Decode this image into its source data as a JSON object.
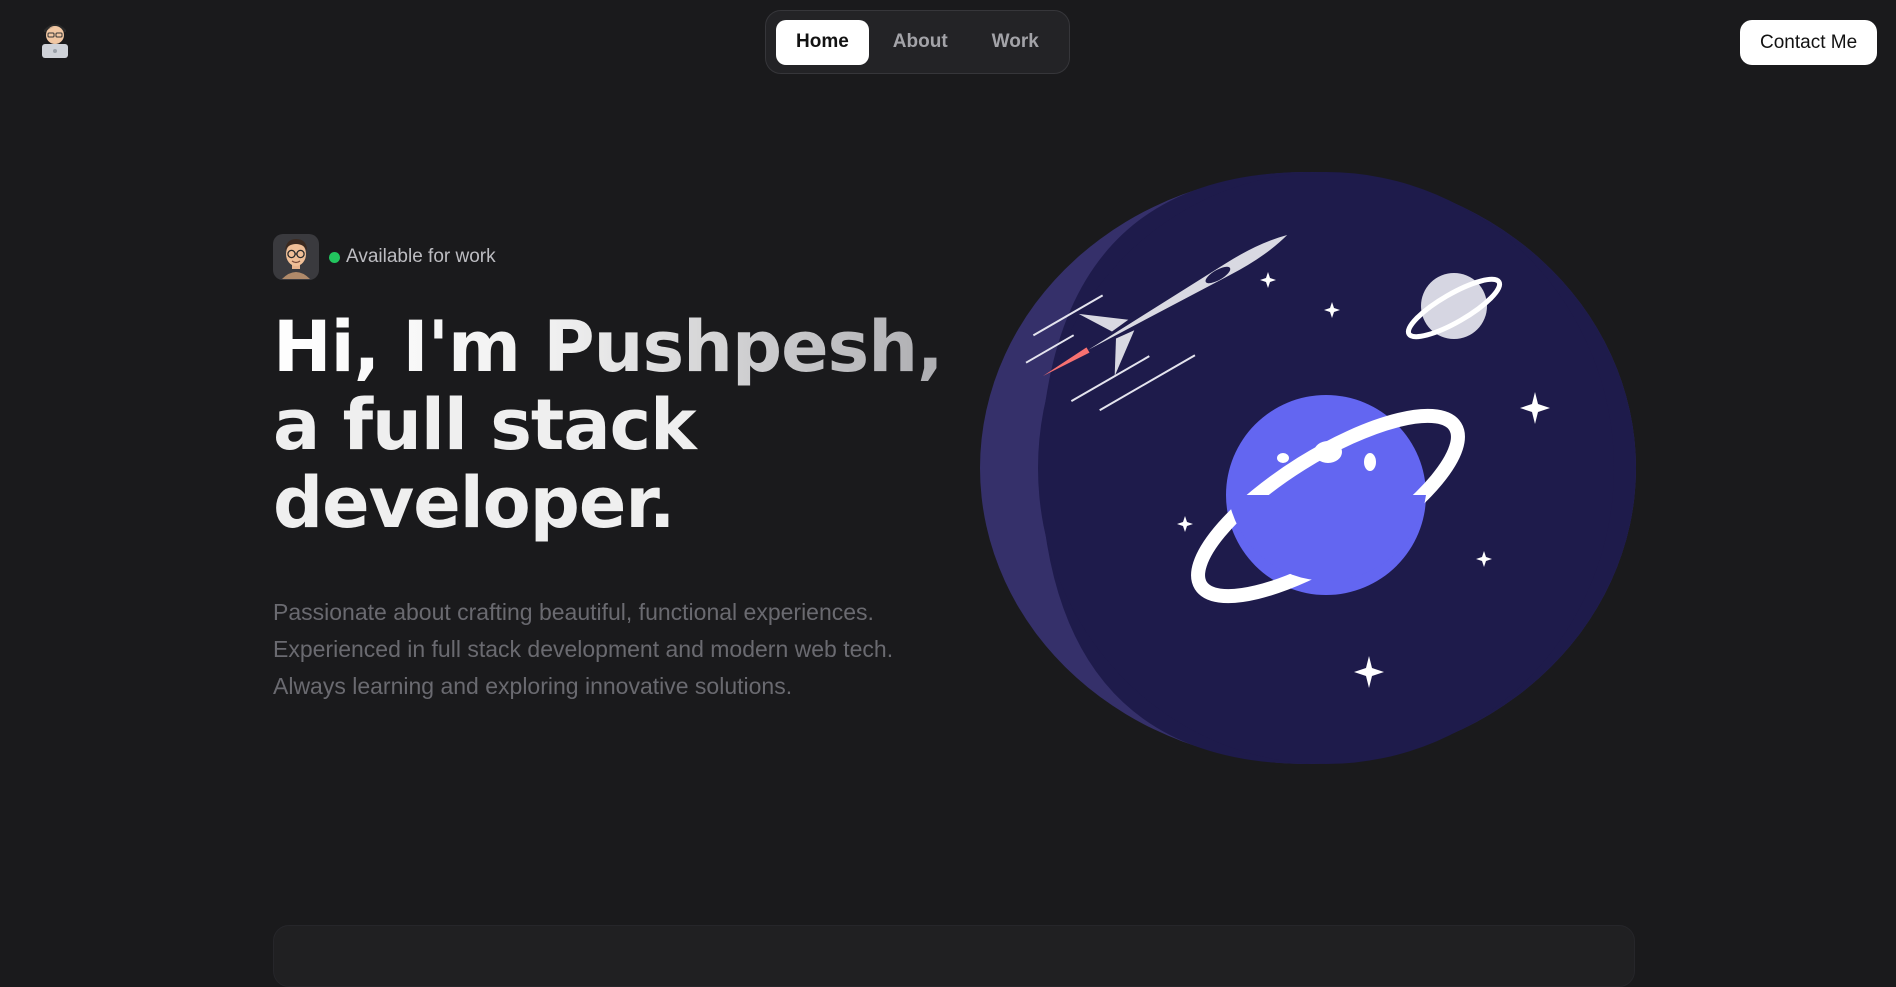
{
  "nav": {
    "logo_icon": "memoji-laptop-avatar-icon",
    "tabs": [
      {
        "label": "Home",
        "active": true
      },
      {
        "label": "About",
        "active": false
      },
      {
        "label": "Work",
        "active": false
      }
    ],
    "contact_label": "Contact Me"
  },
  "hero": {
    "avatar_icon": "memoji-glasses-avatar-icon",
    "status_color": "#22c55e",
    "status_text": "Available for work",
    "headline_lines": [
      "Hi, I'm Pushpesh,",
      "a full stack",
      "developer."
    ],
    "bio_lines": [
      "Passionate about crafting beautiful, functional experiences.",
      "Experienced in full stack development and modern web tech.",
      "Always learning and exploring innovative solutions."
    ]
  },
  "illustration": {
    "icons": [
      "space-circle-icon",
      "rocket-icon",
      "planet-icon",
      "small-planet-icon",
      "sparkle-icon"
    ],
    "colors": {
      "circle": "#1e1b4b",
      "planet": "#6366f1",
      "rocket_flame": "#f87171"
    }
  },
  "theme": {
    "background": "#1a1a1c",
    "accent": "#ffffff"
  }
}
